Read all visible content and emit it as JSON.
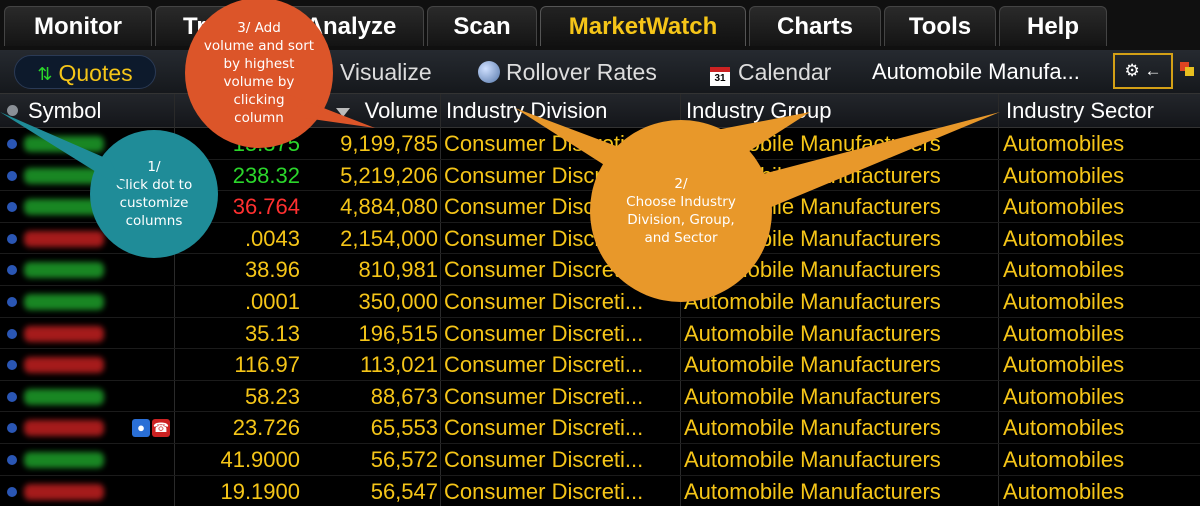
{
  "tabs": [
    "Monitor",
    "Trade",
    "Analyze",
    "Scan",
    "MarketWatch",
    "Charts",
    "Tools",
    "Help"
  ],
  "active_tab": "MarketWatch",
  "toolbar": {
    "quotes": "Quotes",
    "visualize": "Visualize",
    "rollover": "Rollover Rates",
    "calendar": "Calendar",
    "calendar_day": "31",
    "page_name": "Automobile Manufa...",
    "page_controls": "⚙ ← →"
  },
  "columns": {
    "symbol": "Symbol",
    "volume": "Volume",
    "division": "Industry Division",
    "group": "Industry Group",
    "sector": "Industry Sector"
  },
  "rows": [
    {
      "last": "15.375",
      "volume": "9,199,785",
      "division": "Consumer Discreti...",
      "group": "Automobile Manufacturers",
      "sector": "Automobiles",
      "last_color": "#2bd62b",
      "sym_color": "#1e9e2a"
    },
    {
      "last": "238.32",
      "volume": "5,219,206",
      "division": "Consumer Discreti...",
      "group": "Automobile Manufacturers",
      "sector": "Automobiles",
      "last_color": "#2bd62b",
      "sym_color": "#1e9e2a"
    },
    {
      "last": "36.764",
      "volume": "4,884,080",
      "division": "Consumer Discreti...",
      "group": "Automobile Manufacturers",
      "sector": "Automobiles",
      "last_color": "#ff3030",
      "sym_color": "#1e9e2a"
    },
    {
      "last": ".0043",
      "volume": "2,154,000",
      "division": "Consumer Discreti...",
      "group": "Automobile Manufacturers",
      "sector": "Automobiles",
      "last_color": "#f5c518",
      "sym_color": "#c22020"
    },
    {
      "last": "38.96",
      "volume": "810,981",
      "division": "Consumer Discreti...",
      "group": "Automobile Manufacturers",
      "sector": "Automobiles",
      "last_color": "#f5c518",
      "sym_color": "#1e9e2a"
    },
    {
      "last": ".0001",
      "volume": "350,000",
      "division": "Consumer Discreti...",
      "group": "Automobile Manufacturers",
      "sector": "Automobiles",
      "last_color": "#f5c518",
      "sym_color": "#1e9e2a"
    },
    {
      "last": "35.13",
      "volume": "196,515",
      "division": "Consumer Discreti...",
      "group": "Automobile Manufacturers",
      "sector": "Automobiles",
      "last_color": "#f5c518",
      "sym_color": "#c22020"
    },
    {
      "last": "116.97",
      "volume": "113,021",
      "division": "Consumer Discreti...",
      "group": "Automobile Manufacturers",
      "sector": "Automobiles",
      "last_color": "#f5c518",
      "sym_color": "#c22020"
    },
    {
      "last": "58.23",
      "volume": "88,673",
      "division": "Consumer Discreti...",
      "group": "Automobile Manufacturers",
      "sector": "Automobiles",
      "last_color": "#f5c518",
      "sym_color": "#1e9e2a"
    },
    {
      "last": "23.726",
      "volume": "65,553",
      "division": "Consumer Discreti...",
      "group": "Automobile Manufacturers",
      "sector": "Automobiles",
      "last_color": "#f5c518",
      "sym_color": "#c22020",
      "icons": true
    },
    {
      "last": "41.9000",
      "volume": "56,572",
      "division": "Consumer Discreti...",
      "group": "Automobile Manufacturers",
      "sector": "Automobiles",
      "last_color": "#f5c518",
      "sym_color": "#1e9e2a"
    },
    {
      "last": "19.1900",
      "volume": "56,547",
      "division": "Consumer Discreti...",
      "group": "Automobile Manufacturers",
      "sector": "Automobiles",
      "last_color": "#f5c518",
      "sym_color": "#c22020"
    }
  ],
  "callouts": {
    "c1": "1/\nClick dot to\ncustomize\ncolumns",
    "c2": "3/ Add\nvolume and sort\nby highest\nvolume by\nclicking\ncolumn",
    "c3": "2/\nChoose Industry\nDivision, Group,\nand Sector"
  },
  "colors": {
    "accent": "#f5c518",
    "up": "#2bd62b",
    "down": "#ff3030",
    "callout_teal": "#1f8c98",
    "callout_red": "#dc5529",
    "callout_orange": "#e8982a"
  }
}
